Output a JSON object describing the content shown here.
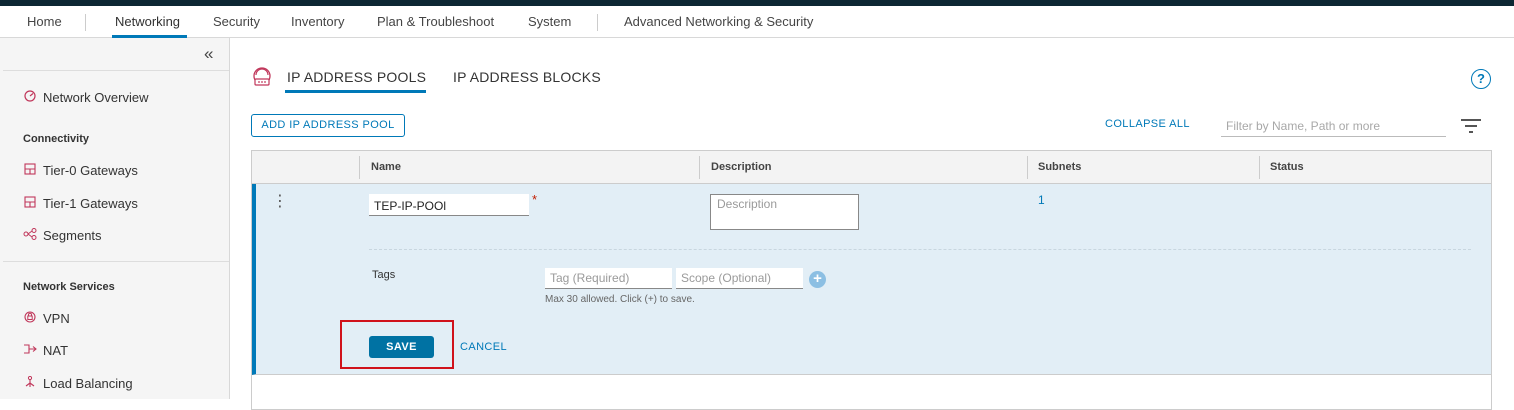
{
  "topnav": {
    "items": [
      "Home",
      "Networking",
      "Security",
      "Inventory",
      "Plan & Troubleshoot",
      "System",
      "Advanced Networking & Security"
    ],
    "active": "Networking"
  },
  "sidebar": {
    "collapse_glyph": "«",
    "overview": "Network Overview",
    "sections": [
      {
        "heading": "Connectivity",
        "items": [
          "Tier-0 Gateways",
          "Tier-1 Gateways",
          "Segments"
        ]
      },
      {
        "heading": "Network Services",
        "items": [
          "VPN",
          "NAT",
          "Load Balancing"
        ]
      }
    ]
  },
  "tabs": [
    "IP ADDRESS POOLS",
    "IP ADDRESS BLOCKS"
  ],
  "toolbar": {
    "add_label": "ADD IP ADDRESS POOL",
    "collapse_all": "COLLAPSE ALL",
    "filter_placeholder": "Filter by Name, Path or more"
  },
  "grid": {
    "columns": [
      "Name",
      "Description",
      "Subnets",
      "Status"
    ],
    "row": {
      "name_value": "TEP-IP-POOl",
      "required_mark": "*",
      "description_placeholder": "Description",
      "subnets": "1",
      "tags_label": "Tags",
      "tag_placeholder": "Tag (Required)",
      "scope_placeholder": "Scope (Optional)",
      "tags_hint": "Max 30 allowed. Click (+) to save.",
      "save_label": "SAVE",
      "cancel_label": "CANCEL"
    }
  },
  "colors": {
    "accent": "#0079b8",
    "brand_strip": "#0d2733",
    "row_selected": "#e2eef6",
    "highlight": "#d0121b"
  },
  "icons": [
    "network-overview-icon",
    "gateway-icon",
    "segments-icon",
    "vpn-icon",
    "nat-icon",
    "load-balancing-icon",
    "ip-pools-icon",
    "help-icon",
    "filter-icon",
    "add-icon",
    "kebab-icon"
  ]
}
